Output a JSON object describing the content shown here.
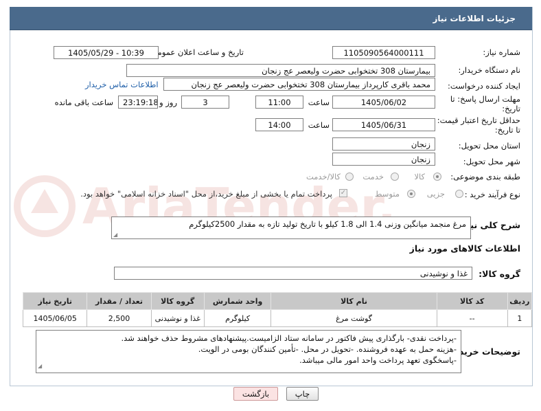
{
  "header": {
    "title": "جزئیات اطلاعات نیاز"
  },
  "fields": {
    "need_number_label": "شماره نیاز:",
    "need_number": "1105090564000111",
    "announce_label": "تاریخ و ساعت اعلان عمومی:",
    "announce_value": "1405/05/29 - 10:39",
    "buyer_org_label": "نام دستگاه خریدار:",
    "buyer_org": "بیمارستان 308 تختخوابی حضرت ولیعصر عج  زنجان",
    "requester_label": "ایجاد کننده درخواست:",
    "requester": "محمد باقری کارپرداز بیمارستان 308 تختخوابی حضرت ولیعصر عج  زنجان",
    "buyer_contact_link": "اطلاعات تماس خریدار",
    "deadline_label": "مهلت ارسال پاسخ: تا تاریخ:",
    "deadline_date": "1405/06/02",
    "time_label": "ساعت",
    "deadline_time": "11:00",
    "days_count": "3",
    "days_label": "روز و",
    "remaining_time": "23:19:18",
    "remaining_label": "ساعت باقی مانده",
    "validity_label": "حداقل تاریخ اعتبار قیمت: تا تاریخ:",
    "validity_date": "1405/06/31",
    "validity_time_label": "ساعت",
    "validity_time": "14:00",
    "province_label": "استان محل تحویل:",
    "province": "زنجان",
    "city_label": "شهر محل تحویل:",
    "city": "زنجان",
    "category_label": "طبقه بندی موضوعی:",
    "category_options": [
      "کالا",
      "خدمت",
      "کالا/خدمت"
    ],
    "purchase_type_label": "نوع فرآیند خرید :",
    "purchase_type_options": [
      "جزیی",
      "متوسط"
    ],
    "payment_note": "پرداخت تمام یا بخشی از مبلغ خرید،از محل \"اسناد خزانه اسلامی\" خواهد بود."
  },
  "summary": {
    "label": "شرح کلی نیاز:",
    "text": "مرغ منجمد میانگین وزنی 1.4 الی 1.8 کیلو با تاریخ تولید تازه به مقدار 2500کیلوگرم"
  },
  "goods_section": {
    "title": "اطلاعات کالاهای مورد نیاز",
    "group_label": "گروه کالا:",
    "group_value": "غذا و نوشیدنی"
  },
  "items_table": {
    "headers": [
      "ردیف",
      "کد کالا",
      "نام کالا",
      "واحد شمارش",
      "گروه کالا",
      "تعداد / مقدار",
      "تاریخ نیاز"
    ],
    "rows": [
      [
        "1",
        "--",
        "گوشت مرغ",
        "کیلوگرم",
        "غذا و نوشیدنی",
        "2,500",
        "1405/06/05"
      ]
    ]
  },
  "buyer_notes": {
    "label": "توضیحات خریدار:",
    "lines": [
      "-پرداخت  نقدی- بارگذاری پیش فاکتور در سامانه ستاد الزامیست.پیشنهادهای مشروط حذف خواهند شد.",
      "-هزینه حمل به عهده فروشنده. -تحویل در محل. -تأمین کنندگان بومی در الویت.",
      "-پاسخگوی تعهد پرداخت واحد امور مالی میباشد."
    ]
  },
  "buttons": {
    "print": "چاپ",
    "back": "بازگشت"
  },
  "watermark": {
    "text": "AriaTender.neT",
    "color": "#c0392b"
  }
}
